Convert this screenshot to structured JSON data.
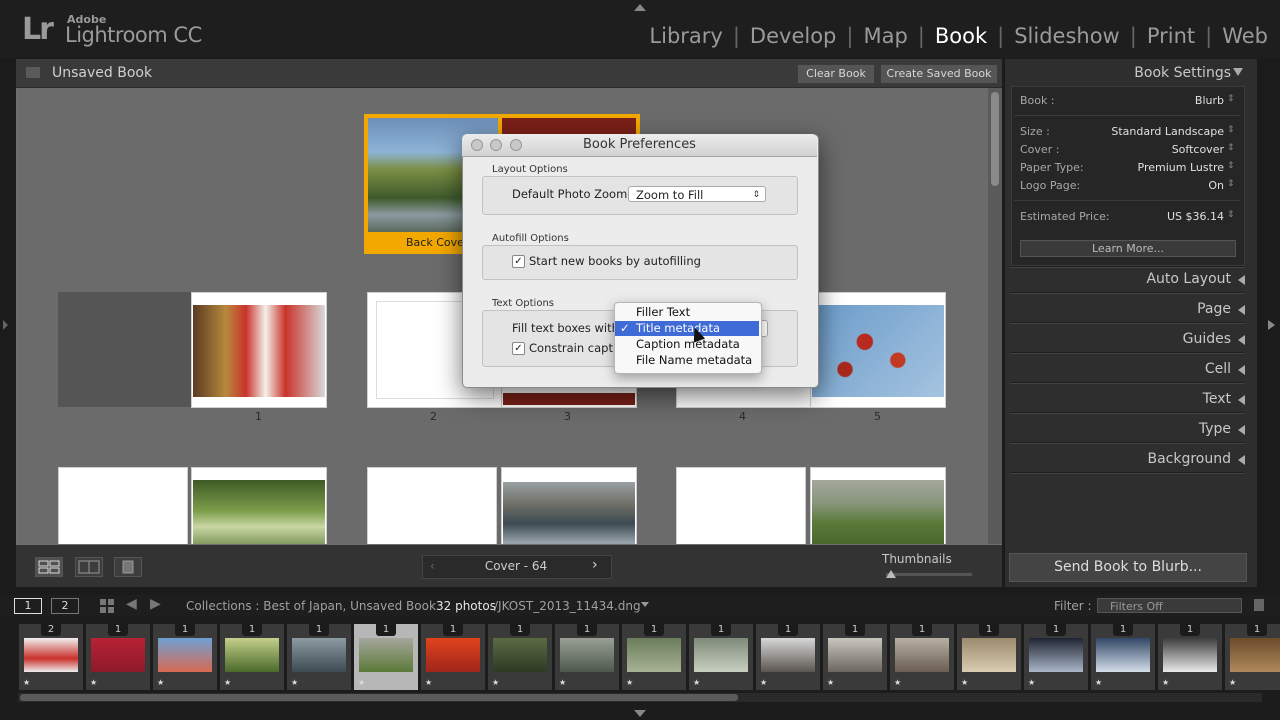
{
  "app": {
    "adobe": "Adobe",
    "name": "Lightroom CC",
    "logo": "Lr"
  },
  "modules": [
    "Library",
    "Develop",
    "Map",
    "Book",
    "Slideshow",
    "Print",
    "Web"
  ],
  "active_module": "Book",
  "book": {
    "title": "Unsaved Book",
    "clear_label": "Clear Book",
    "create_label": "Create Saved Book"
  },
  "spread": {
    "back_cover_label": "Back Cover",
    "page_numbers": [
      "1",
      "2",
      "3",
      "4",
      "5"
    ]
  },
  "toolbar": {
    "page_nav_label": "Cover - 64",
    "thumbnails_label": "Thumbnails",
    "thumbnail_size": 0.04
  },
  "book_settings": {
    "header": "Book Settings",
    "book_label": "Book :",
    "book_value": "Blurb",
    "size_label": "Size :",
    "size_value": "Standard Landscape",
    "cover_label": "Cover :",
    "cover_value": "Softcover",
    "paper_label": "Paper Type:",
    "paper_value": "Premium Lustre",
    "logo_label": "Logo Page:",
    "logo_value": "On",
    "price_label": "Estimated Price:",
    "price_value": "US $36.14",
    "learn_more": "Learn More..."
  },
  "panels": [
    "Auto Layout",
    "Page",
    "Guides",
    "Cell",
    "Text",
    "Type",
    "Background"
  ],
  "send_label": "Send Book to Blurb...",
  "dialog": {
    "title": "Book Preferences",
    "layout_section": "Layout Options",
    "zoom_label": "Default Photo Zoom:",
    "zoom_value": "Zoom to Fill",
    "autofill_section": "Autofill Options",
    "autofill_label": "Start new books by autofilling",
    "text_section": "Text Options",
    "fill_label": "Fill text boxes with",
    "constrain_label": "Constrain captio",
    "fill_options": [
      "Filler Text",
      "Title metadata",
      "Caption metadata",
      "File Name metadata"
    ],
    "fill_selected": "Title metadata"
  },
  "filmstrip_bar": {
    "view1": "1",
    "view2": "2",
    "path": "Collections : Best of Japan, Unsaved Book",
    "count": "32 photos",
    "file": "/JKOST_2013_11434.dng",
    "filter_label": "Filter :",
    "filter_value": "Filters Off"
  },
  "filmstrip_counts": [
    "2",
    "1",
    "1",
    "1",
    "1",
    "1",
    "1",
    "1",
    "1",
    "1",
    "1",
    "1",
    "1",
    "1",
    "1",
    "1",
    "1",
    "1",
    "1"
  ],
  "colors": {
    "accent_selected": "#f2a800",
    "highlight": "#3f6bd6",
    "module_active": "#ffffff"
  }
}
